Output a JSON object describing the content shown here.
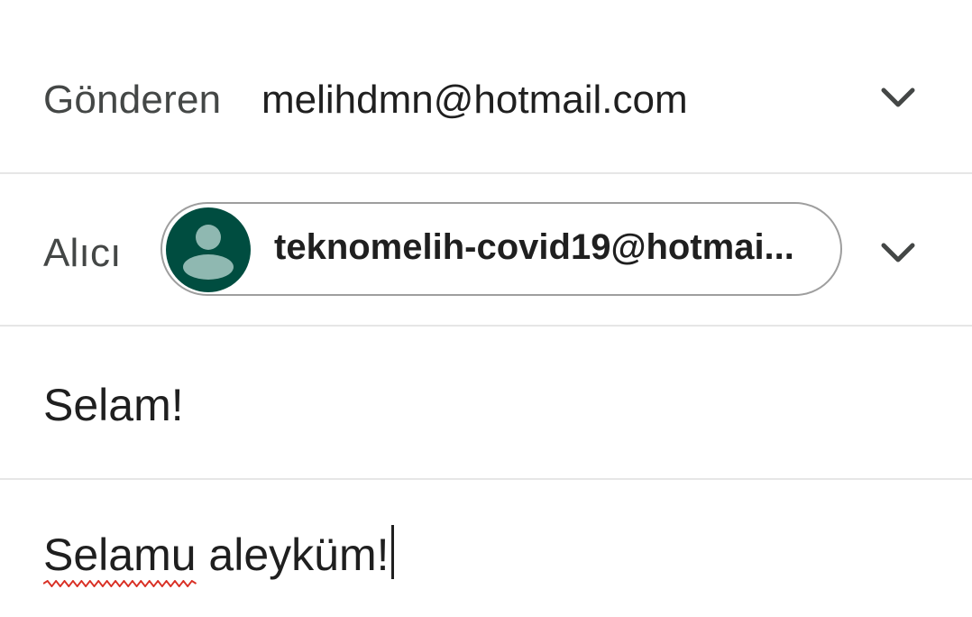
{
  "from": {
    "label": "Gönderen",
    "value": "melihdmn@hotmail.com"
  },
  "to": {
    "label": "Alıcı",
    "recipient": "teknomelih-covid19@hotmai..."
  },
  "subject": {
    "value": "Selam!"
  },
  "body": {
    "misspelled_word": "Selamu",
    "rest": " aleyküm!"
  },
  "icons": {
    "from_chevron": "chevron-down-icon",
    "to_chevron": "chevron-down-icon",
    "avatar": "person-icon"
  },
  "colors": {
    "avatar_bg": "#004d40",
    "avatar_fg": "#8fb8b1",
    "spellcheck": "#d93025"
  }
}
